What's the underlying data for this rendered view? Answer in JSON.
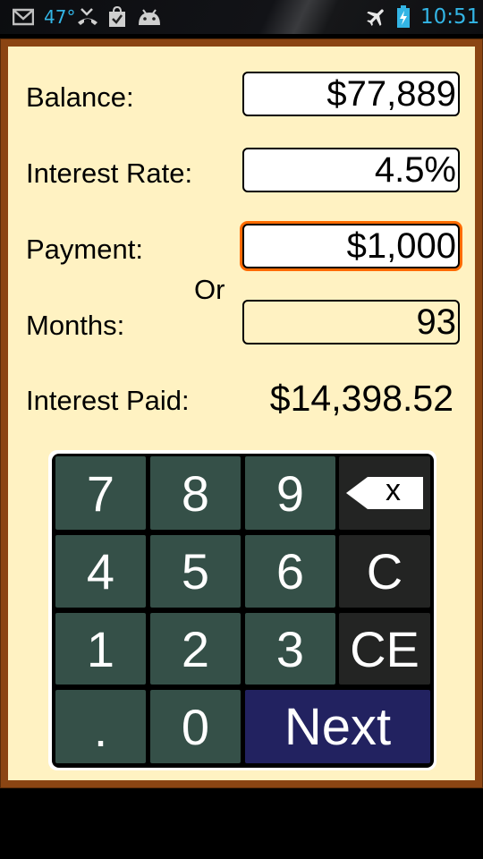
{
  "status_bar": {
    "icons": [
      "gmail-icon",
      "missed-call-icon",
      "shopping-bag-check-icon",
      "android-icon",
      "airplane-mode-icon",
      "battery-charging-icon"
    ],
    "temperature": "47°",
    "time": "10:51",
    "accent_color": "#33b5e5"
  },
  "form": {
    "balance_label": "Balance:",
    "balance_value": "$77,889",
    "rate_label": "Interest Rate:",
    "rate_value": "4.5%",
    "payment_label": "Payment:",
    "payment_value": "$1,000",
    "or_label": "Or",
    "months_label": "Months:",
    "months_value": "93",
    "interest_paid_label": "Interest Paid:",
    "interest_paid_value": "$14,398.52",
    "focused_field": "payment",
    "focus_color": "#ff6a00"
  },
  "keypad": {
    "keys": [
      "7",
      "8",
      "9",
      "backspace",
      "4",
      "5",
      "6",
      "C",
      "1",
      "2",
      "3",
      "CE",
      ".",
      "0",
      "Next"
    ],
    "backspace_glyph": "x",
    "clear_label": "C",
    "clear_entry_label": "CE",
    "next_label": "Next"
  }
}
